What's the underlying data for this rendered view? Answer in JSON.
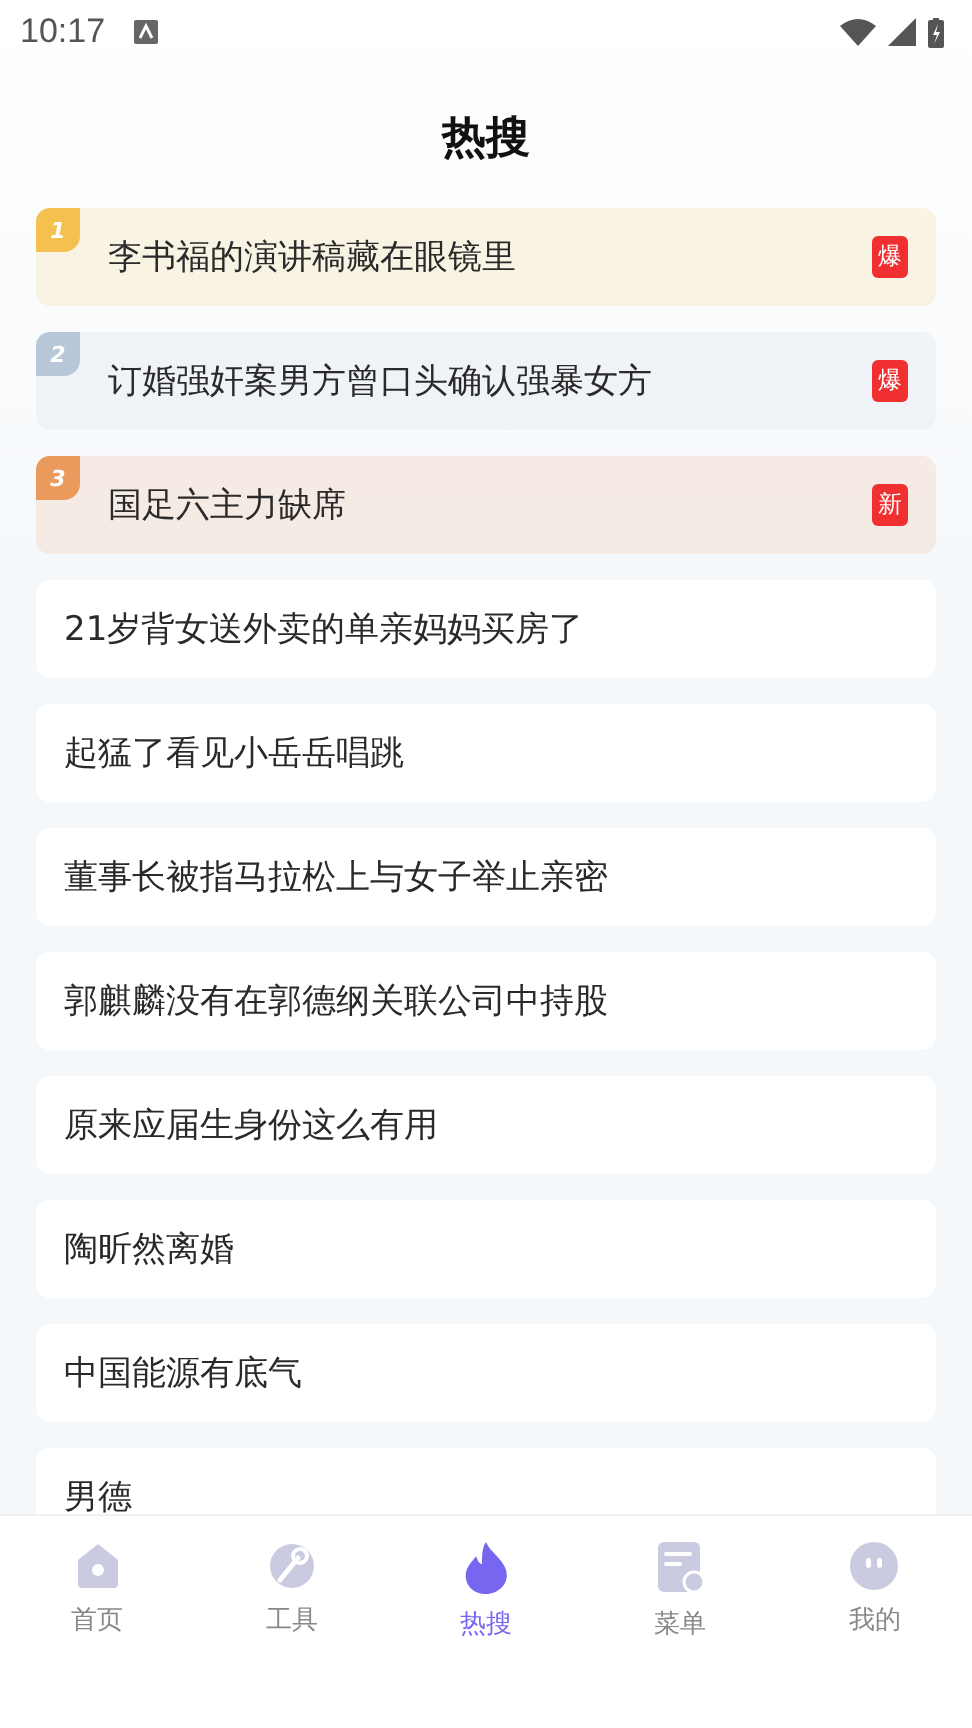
{
  "status_bar": {
    "time": "10:17"
  },
  "title": "热搜",
  "items": [
    {
      "rank": "1",
      "color": "#f4c050",
      "text": "李书福的演讲稿藏在眼镜里",
      "tag": "爆"
    },
    {
      "rank": "2",
      "color": "#b9c8d8",
      "text": "订婚强奸案男方曾口头确认强暴女方",
      "tag": "爆"
    },
    {
      "rank": "3",
      "color": "#eb9a5e",
      "text": "国足六主力缺席",
      "tag": "新"
    },
    {
      "text": "21岁背女送外卖的单亲妈妈买房了"
    },
    {
      "text": "起猛了看见小岳岳唱跳"
    },
    {
      "text": "董事长被指马拉松上与女子举止亲密"
    },
    {
      "text": "郭麒麟没有在郭德纲关联公司中持股"
    },
    {
      "text": "原来应届生身份这么有用"
    },
    {
      "text": "陶昕然离婚"
    },
    {
      "text": "中国能源有底气"
    },
    {
      "text": "男德"
    }
  ],
  "nav": [
    {
      "label": "首页",
      "kind": "home",
      "selected": false
    },
    {
      "label": "工具",
      "kind": "tools",
      "selected": false
    },
    {
      "label": "热搜",
      "kind": "hot",
      "selected": true
    },
    {
      "label": "菜单",
      "kind": "menu",
      "selected": false
    },
    {
      "label": "我的",
      "kind": "me",
      "selected": false
    }
  ]
}
